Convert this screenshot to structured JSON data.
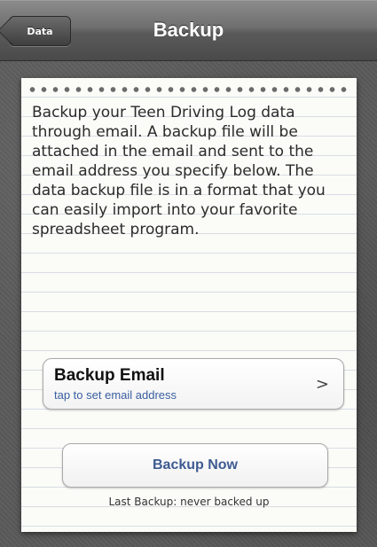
{
  "nav": {
    "back_label": "Data",
    "title": "Backup"
  },
  "description": "Backup your Teen Driving Log data through email. A backup file will be attached in the email and sent to the email address you specify below. The data backup file is in a format that you can easily import into your favorite spreadsheet program.",
  "backup_email": {
    "title": "Backup Email",
    "subtitle": "tap to set email address",
    "chevron": ">"
  },
  "backup_button": {
    "label": "Backup Now"
  },
  "last_backup": "Last Backup: never backed up",
  "icons": {
    "back": "back-arrow-icon",
    "disclosure": "chevron-right-icon"
  }
}
